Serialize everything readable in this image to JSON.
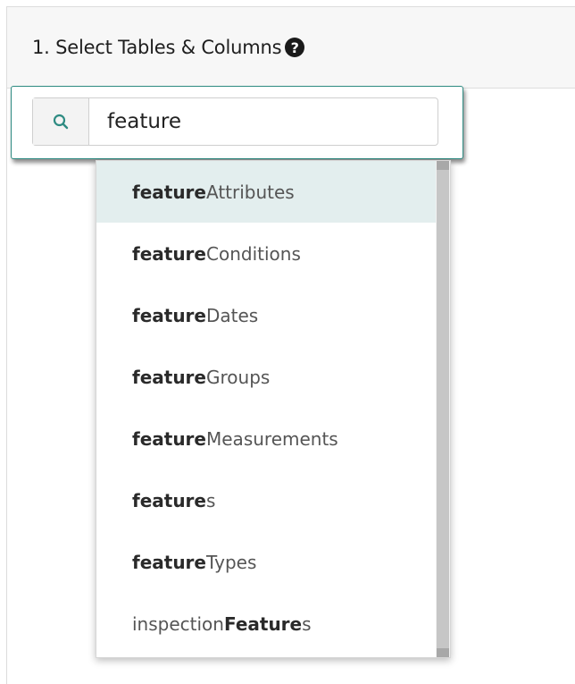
{
  "header": {
    "title": "1. Select Tables & Columns",
    "help_icon": "question-circle-icon"
  },
  "search": {
    "icon": "search-icon",
    "value": "feature",
    "accent_color": "#2e8b82"
  },
  "dropdown": {
    "options": [
      {
        "match": "feature",
        "rest": "Attributes",
        "prefix": "",
        "active": true
      },
      {
        "match": "feature",
        "rest": "Conditions",
        "prefix": ""
      },
      {
        "match": "feature",
        "rest": "Dates",
        "prefix": ""
      },
      {
        "match": "feature",
        "rest": "Groups",
        "prefix": ""
      },
      {
        "match": "feature",
        "rest": "Measurements",
        "prefix": ""
      },
      {
        "match": "feature",
        "rest": "s",
        "prefix": ""
      },
      {
        "match": "feature",
        "rest": "Types",
        "prefix": ""
      },
      {
        "prefix": "inspection",
        "match": "Feature",
        "rest": "s"
      }
    ]
  }
}
